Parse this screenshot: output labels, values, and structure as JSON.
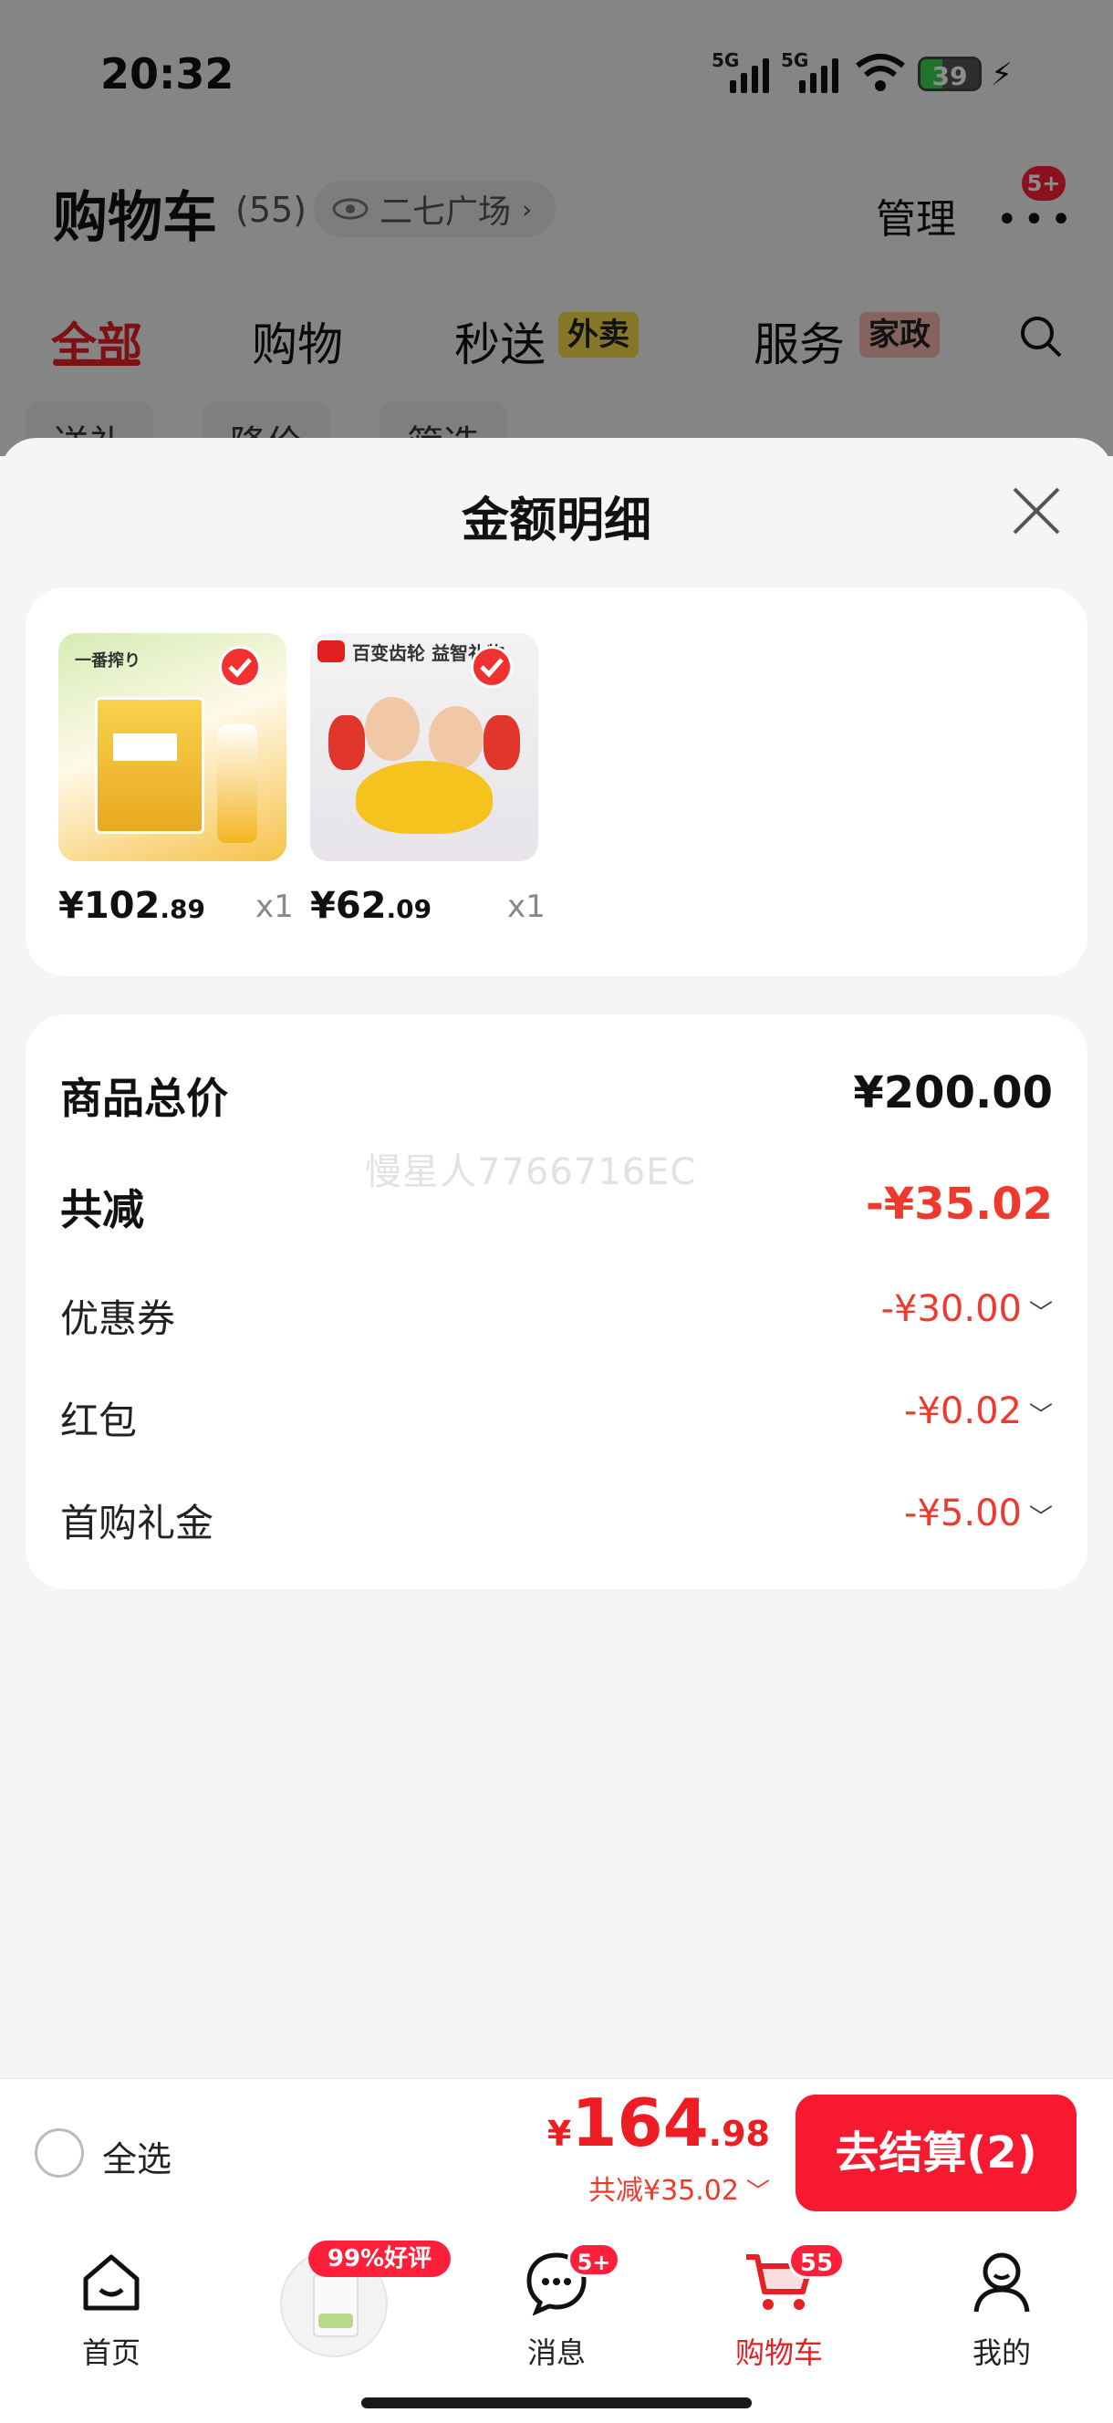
{
  "status_bar": {
    "time": "20:32",
    "signal1": "5G",
    "signal2": "5G",
    "battery": "39"
  },
  "header": {
    "title": "购物车",
    "count": "(55)",
    "location": "二七广场",
    "manage": "管理",
    "more_badge": "5+"
  },
  "tabs": [
    {
      "label": "全部",
      "active": true
    },
    {
      "label": "购物"
    },
    {
      "label": "秒送",
      "tag": "外卖"
    },
    {
      "label": "服务",
      "tag": "家政"
    }
  ],
  "filters": [
    "送礼",
    "降价",
    "筛选"
  ],
  "sheet": {
    "title": "金额明细",
    "items": [
      {
        "name": "一番搾り",
        "price_int": "¥102",
        "price_dec": ".89",
        "qty": "x1",
        "banner": "一番搾り"
      },
      {
        "name": "百变齿轮 益智礼物",
        "price_int": "¥62",
        "price_dec": ".09",
        "qty": "x1",
        "banner": "百变齿轮  益智礼物"
      }
    ],
    "summary": {
      "total_label": "商品总价",
      "total_value": "¥200.00",
      "discount_label": "共减",
      "discount_value": "-¥35.02",
      "lines": [
        {
          "label": "优惠券",
          "value": "-¥30.00"
        },
        {
          "label": "红包",
          "value": "-¥0.02"
        },
        {
          "label": "首购礼金",
          "value": "-¥5.00"
        }
      ]
    },
    "watermark": "慢星人7766716EC"
  },
  "footer": {
    "select_all": "全选",
    "total_currency": "¥",
    "total_int": "164",
    "total_dec": ".98",
    "saved": "共减¥35.02",
    "checkout": "去结算(2)"
  },
  "bottom_nav": [
    {
      "label": "首页",
      "icon": "home-icon"
    },
    {
      "label": "",
      "icon": "product-thumbnail",
      "badge": "99%好评"
    },
    {
      "label": "消息",
      "icon": "message-icon",
      "badge": "5+"
    },
    {
      "label": "购物车",
      "icon": "cart-icon",
      "badge": "55",
      "active": true
    },
    {
      "label": "我的",
      "icon": "profile-icon"
    }
  ],
  "colors": {
    "accent": "#e42025",
    "checkout": "#f6192f",
    "discount": "#ee3a2d",
    "tag_yellow": "#f5d84a",
    "tag_pink": "#f3b6b0"
  }
}
